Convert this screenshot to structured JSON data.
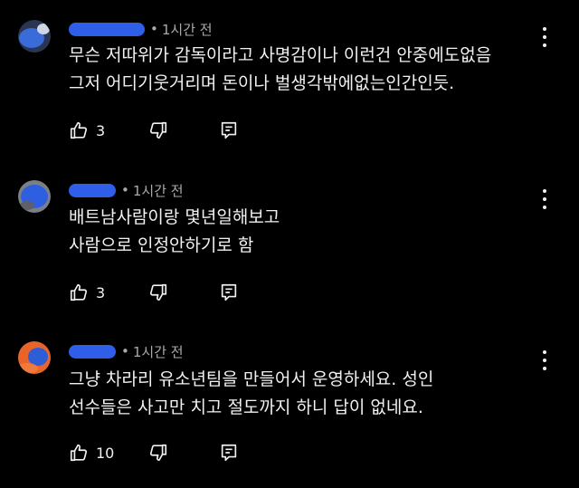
{
  "comments": [
    {
      "timestamp": "1시간 전",
      "avatar_color": "#3b6bd8",
      "lines": [
        "무슨 저따위가 감독이라고 사명감이나 이런건 안중에도없음",
        "그저 어디기웃거리며 돈이나 벌생각밖에없는인간인듯."
      ],
      "likes": "3"
    },
    {
      "timestamp": "1시간 전",
      "avatar_color": "#2e5fe0",
      "lines": [
        "배트남사람이랑 몇년일해보고",
        "사람으로 인정안하기로 함"
      ],
      "likes": "3"
    },
    {
      "timestamp": "1시간 전",
      "avatar_color": "#e8642a",
      "lines": [
        "그냥 차라리 유소년팀을 만들어서 운영하세요. 성인",
        "선수들은 사고만 치고 절도까지 하니 답이 없네요."
      ],
      "likes": "10"
    }
  ],
  "colors": {
    "background": "#000000",
    "text": "#f1f1f1",
    "secondary_text": "#aaaaaa",
    "redaction": "#2f5fe8"
  },
  "icons": [
    "like-icon",
    "dislike-icon",
    "reply-icon",
    "more-options-icon"
  ]
}
